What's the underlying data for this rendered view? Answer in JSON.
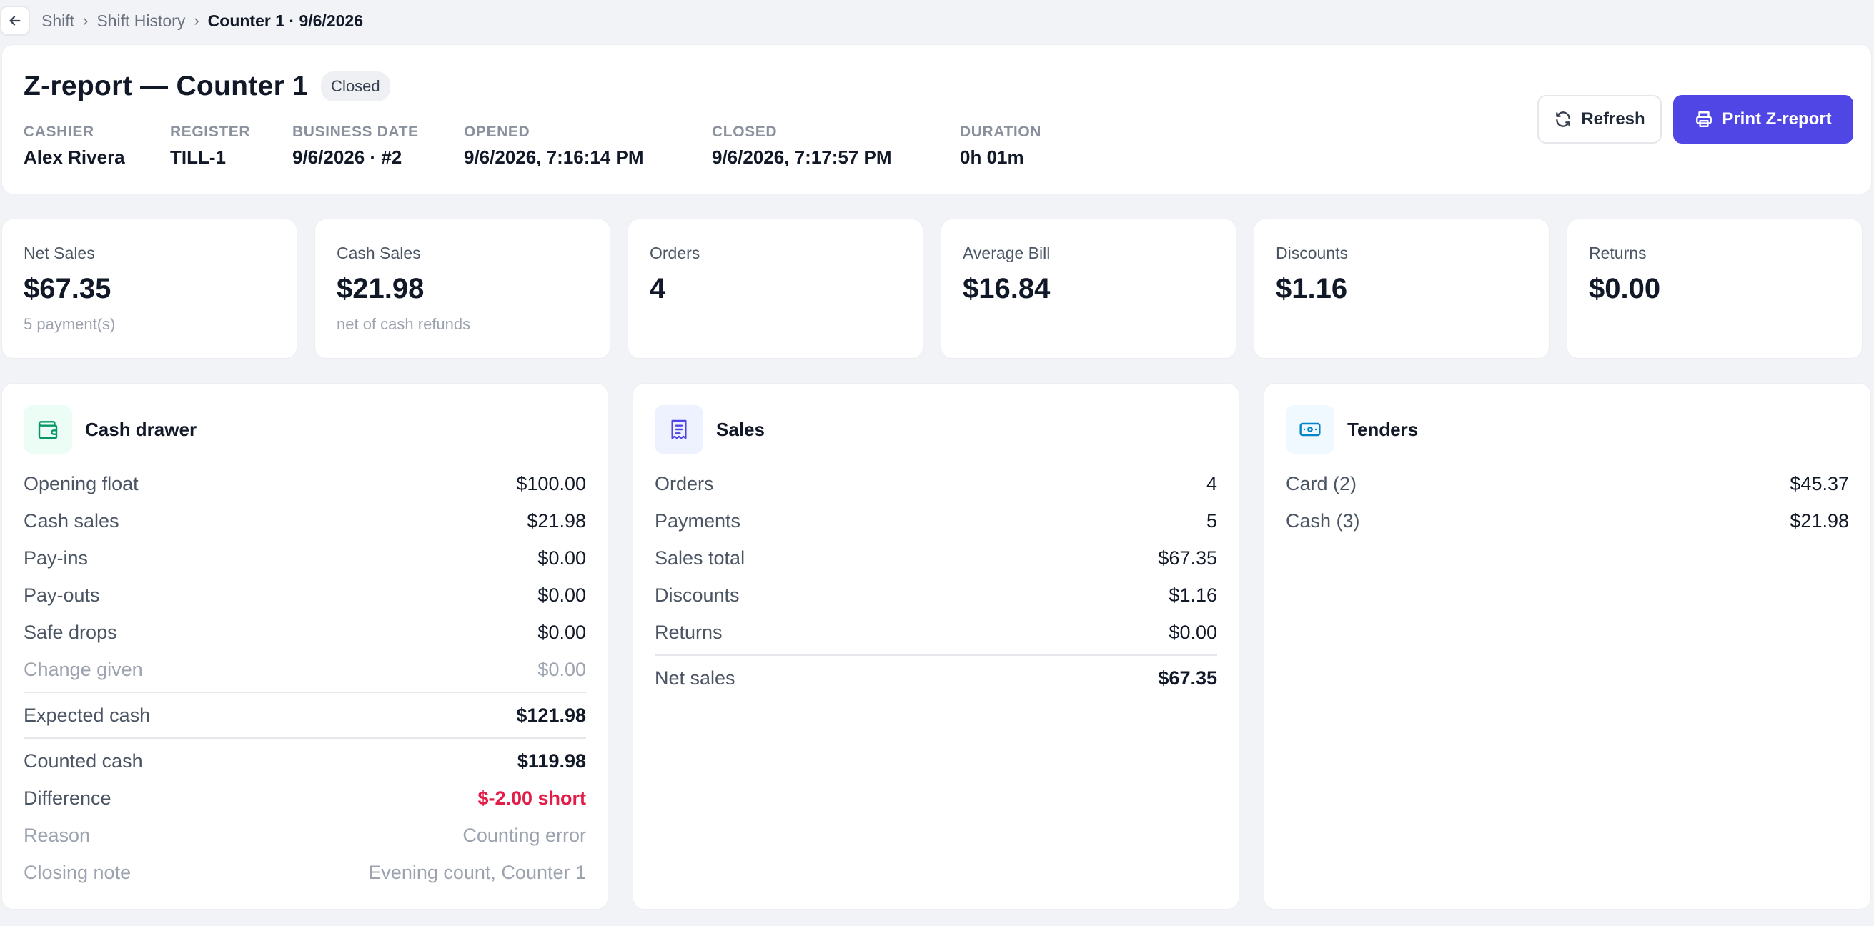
{
  "breadcrumb": {
    "items": [
      "Shift",
      "Shift History"
    ],
    "current": "Counter 1 · 9/6/2026"
  },
  "header": {
    "title": "Z-report — Counter 1",
    "status": "Closed",
    "meta": [
      {
        "label": "CASHIER",
        "value": "Alex Rivera"
      },
      {
        "label": "REGISTER",
        "value": "TILL-1"
      },
      {
        "label": "BUSINESS DATE",
        "value": "9/6/2026 · #2"
      },
      {
        "label": "OPENED",
        "value": "9/6/2026, 7:16:14 PM"
      },
      {
        "label": "CLOSED",
        "value": "9/6/2026, 7:17:57 PM"
      },
      {
        "label": "DURATION",
        "value": "0h 01m"
      }
    ],
    "refresh_label": "Refresh",
    "print_label": "Print Z-report"
  },
  "stats": [
    {
      "label": "Net Sales",
      "value": "$67.35",
      "sub": "5 payment(s)"
    },
    {
      "label": "Cash Sales",
      "value": "$21.98",
      "sub": "net of cash refunds"
    },
    {
      "label": "Orders",
      "value": "4",
      "sub": ""
    },
    {
      "label": "Average Bill",
      "value": "$16.84",
      "sub": ""
    },
    {
      "label": "Discounts",
      "value": "$1.16",
      "sub": ""
    },
    {
      "label": "Returns",
      "value": "$0.00",
      "sub": ""
    }
  ],
  "cash_drawer": {
    "title": "Cash drawer",
    "rows": [
      {
        "label": "Opening float",
        "value": "$100.00"
      },
      {
        "label": "Cash sales",
        "value": "$21.98"
      },
      {
        "label": "Pay-ins",
        "value": "$0.00"
      },
      {
        "label": "Pay-outs",
        "value": "$0.00"
      },
      {
        "label": "Safe drops",
        "value": "$0.00"
      },
      {
        "label": "Change given",
        "value": "$0.00"
      },
      {
        "label": "Expected cash",
        "value": "$121.98"
      },
      {
        "label": "Counted cash",
        "value": "$119.98"
      },
      {
        "label": "Difference",
        "value": "$-2.00 short"
      },
      {
        "label": "Reason",
        "value": "Counting error"
      },
      {
        "label": "Closing note",
        "value": "Evening count, Counter 1"
      }
    ]
  },
  "sales": {
    "title": "Sales",
    "rows": [
      {
        "label": "Orders",
        "value": "4"
      },
      {
        "label": "Payments",
        "value": "5"
      },
      {
        "label": "Sales total",
        "value": "$67.35"
      },
      {
        "label": "Discounts",
        "value": "$1.16"
      },
      {
        "label": "Returns",
        "value": "$0.00"
      },
      {
        "label": "Net sales",
        "value": "$67.35"
      }
    ]
  },
  "tenders": {
    "title": "Tenders",
    "rows": [
      {
        "label": "Card (2)",
        "value": "$45.37"
      },
      {
        "label": "Cash (3)",
        "value": "$21.98"
      }
    ]
  },
  "colors": {
    "accent": "#4f46e5",
    "danger": "#e11d48",
    "cash_icon": "#059669",
    "sales_icon": "#4f46e5",
    "tenders_icon": "#0284c7"
  },
  "icons": {
    "back": "arrow-left-icon",
    "refresh": "refresh-icon",
    "print": "printer-icon",
    "cash_drawer": "wallet-icon",
    "sales": "receipt-icon",
    "tenders": "banknote-icon"
  }
}
